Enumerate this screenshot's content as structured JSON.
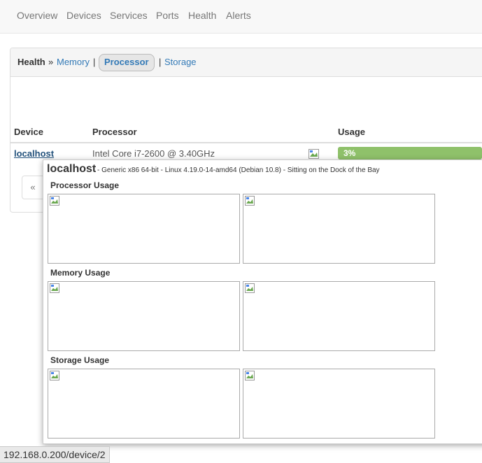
{
  "nav": {
    "items": [
      "Overview",
      "Devices",
      "Services",
      "Ports",
      "Health",
      "Alerts"
    ]
  },
  "breadcrumb": {
    "root": "Health",
    "arrow": "»",
    "memory": "Memory",
    "sep1": "|",
    "processor": "Processor",
    "sep2": "|",
    "storage": "Storage"
  },
  "table": {
    "headers": {
      "device": "Device",
      "processor": "Processor",
      "usage": "Usage"
    },
    "rows": [
      {
        "device": "localhost",
        "processor": "Intel Core i7-2600 @ 3.40GHz",
        "usage": "3%",
        "usage_fraction": 0.03
      }
    ]
  },
  "pager": {
    "prev": "«"
  },
  "popup": {
    "hostname": "localhost",
    "description": "- Generic x86 64-bit - Linux 4.19.0-14-amd64 (Debian 10.8) - Sitting on the Dock of the Bay",
    "sections": [
      {
        "title": "Processor Usage"
      },
      {
        "title": "Memory Usage"
      },
      {
        "title": "Storage Usage"
      }
    ]
  },
  "status_bar": {
    "url": "192.168.0.200/device/2"
  },
  "colors": {
    "link": "#337ab7",
    "usage_bar": "#8fc16a",
    "navbar_bg": "#f8f8f8"
  },
  "icons": {
    "broken_image": "broken-image-icon"
  }
}
